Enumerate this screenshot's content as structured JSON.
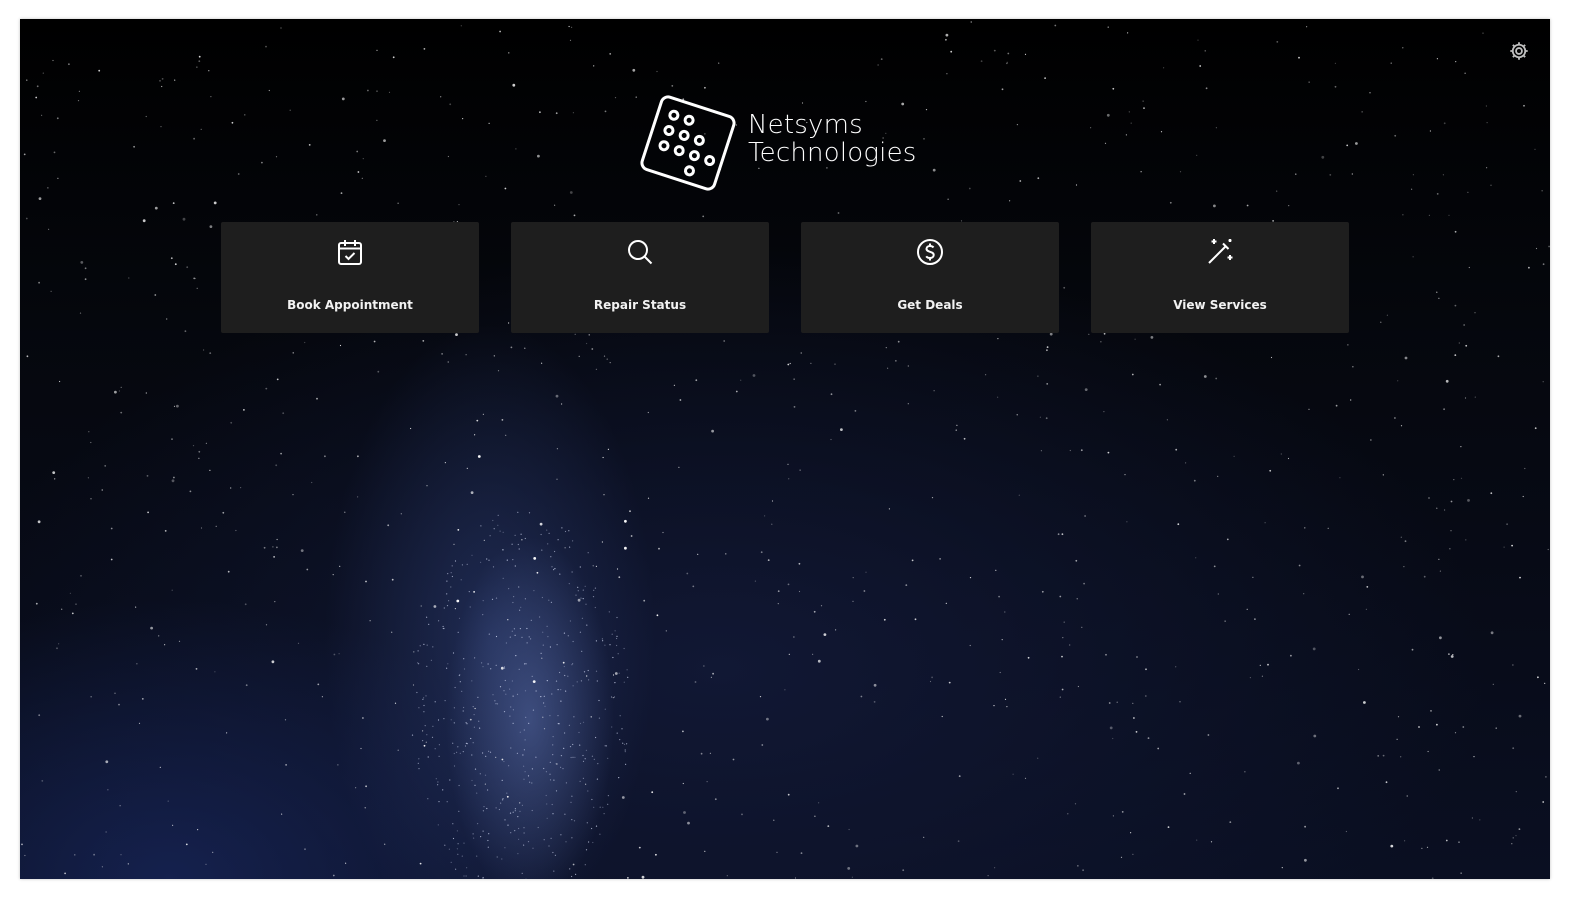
{
  "brand": {
    "name_line1": "Netsyms",
    "name_line2": "Technologies"
  },
  "colors": {
    "tile_bg": "#1e1e1e",
    "text": "#ffffff",
    "sky_top": "#000000",
    "sky_bottom": "#0a0f22"
  },
  "header": {
    "settings_icon": "gear-icon"
  },
  "tiles": [
    {
      "label": "Book Appointment",
      "icon": "calendar-check-icon"
    },
    {
      "label": "Repair Status",
      "icon": "search-icon"
    },
    {
      "label": "Get Deals",
      "icon": "dollar-coin-icon"
    },
    {
      "label": "View Services",
      "icon": "magic-wand-icon"
    }
  ]
}
